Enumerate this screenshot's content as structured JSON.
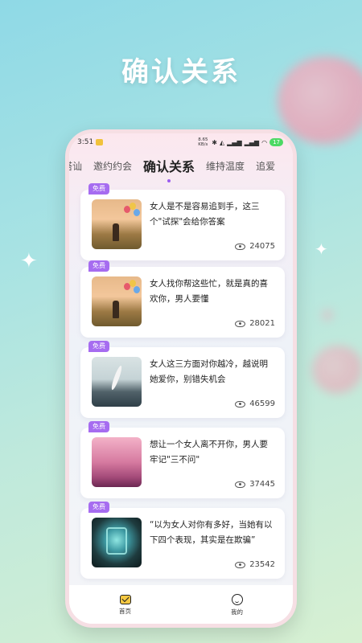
{
  "promo": {
    "title": "确认关系"
  },
  "status_bar": {
    "time": "3:51",
    "net_speed": "8.65 KB/s",
    "battery": "17"
  },
  "tabs": [
    {
      "label": "搭讪",
      "active": false
    },
    {
      "label": "邀约约会",
      "active": false
    },
    {
      "label": "确认关系",
      "active": true
    },
    {
      "label": "维持温度",
      "active": false
    },
    {
      "label": "追爱",
      "active": false
    }
  ],
  "articles": [
    {
      "badge": "免费",
      "title": "女人是不是容易追到手，这三个\"试探\"会给你答案",
      "views": "24075",
      "thumb": "sunset-girl-balloons"
    },
    {
      "badge": "免费",
      "title": "女人找你帮这些忙，就是真的喜欢你，男人要懂",
      "views": "28021",
      "thumb": "sunset-girl-balloons"
    },
    {
      "badge": "免费",
      "title": "女人这三方面对你越冷，越说明她爱你，别错失机会",
      "views": "46599",
      "thumb": "sea-feather"
    },
    {
      "badge": "免费",
      "title": "想让一个女人离不开你，男人要牢记\"三不问\"",
      "views": "37445",
      "thumb": "pink-sky"
    },
    {
      "badge": "免费",
      "title": "“以为女人对你有多好，当她有以下四个表现，其实是在欺骗”",
      "views": "23542",
      "thumb": "magic-book"
    }
  ],
  "bottom_nav": [
    {
      "label": "首页",
      "icon": "home-icon",
      "active": true
    },
    {
      "label": "我的",
      "icon": "smile-icon",
      "active": false
    }
  ],
  "colors": {
    "badge": "#a66cf0",
    "accent_dot": "#9b5cf0"
  }
}
